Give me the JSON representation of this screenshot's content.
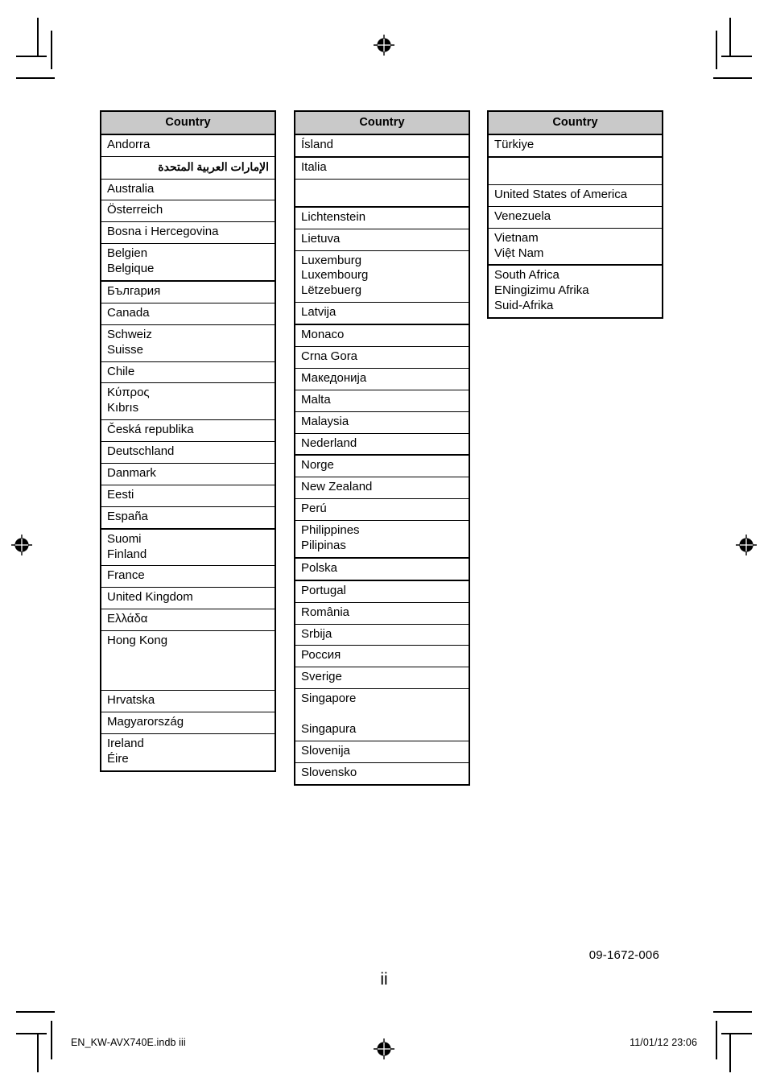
{
  "page": {
    "folio": "ii",
    "doc_code": "09-1672-006",
    "slug_left": "EN_KW-AVX740E.indb   iii",
    "slug_right": "11/01/12   23:06"
  },
  "tables": [
    {
      "name": "country-table-column-1",
      "header": "Country",
      "rows": [
        {
          "text": "Andorra",
          "rule": "thin"
        },
        {
          "text": "الإمارات العربية المتحدة",
          "rule": "thin",
          "dir": "rtl"
        },
        {
          "text": "Australia",
          "rule": "thin"
        },
        {
          "text": "Österreich",
          "rule": "thin"
        },
        {
          "text": "Bosna i Hercegovina",
          "rule": "thin"
        },
        {
          "text": "Belgien\nBelgique",
          "rule": "thick"
        },
        {
          "text": "България",
          "rule": "thin"
        },
        {
          "text": "Canada",
          "rule": "thin"
        },
        {
          "text": "Schweiz\nSuisse",
          "rule": "thin"
        },
        {
          "text": "Chile",
          "rule": "thin"
        },
        {
          "text": "Κύπρος\nKıbrıs",
          "rule": "thin"
        },
        {
          "text": "Česká republika",
          "rule": "thin"
        },
        {
          "text": "Deutschland",
          "rule": "thin"
        },
        {
          "text": "Danmark",
          "rule": "thin"
        },
        {
          "text": "Eesti",
          "rule": "thin"
        },
        {
          "text": "España",
          "rule": "thick"
        },
        {
          "text": "Suomi\nFinland",
          "rule": "thin"
        },
        {
          "text": "France",
          "rule": "thin"
        },
        {
          "text": "United Kingdom",
          "rule": "thin"
        },
        {
          "text": "Ελλάδα",
          "rule": "thin"
        },
        {
          "text": "Hong Kong",
          "rule": "thin",
          "height": "extra-tall"
        },
        {
          "text": "Hrvatska",
          "rule": "thin"
        },
        {
          "text": "Magyarország",
          "rule": "thin"
        },
        {
          "text": "Ireland\nÉire",
          "rule": "none"
        }
      ]
    },
    {
      "name": "country-table-column-2",
      "header": "Country",
      "rows": [
        {
          "text": "Ísland",
          "rule": "thick"
        },
        {
          "text": "Italia",
          "rule": "thin"
        },
        {
          "text": "",
          "rule": "thick",
          "height": "tall-blank"
        },
        {
          "text": "Lichtenstein",
          "rule": "thin"
        },
        {
          "text": "Lietuva",
          "rule": "thin"
        },
        {
          "text": "Luxemburg\nLuxembourg\nLëtzebuerg",
          "rule": "thin"
        },
        {
          "text": "Latvija",
          "rule": "thick"
        },
        {
          "text": "Monaco",
          "rule": "thin"
        },
        {
          "text": "Crna Gora",
          "rule": "thin"
        },
        {
          "text": "Македонија",
          "rule": "thin"
        },
        {
          "text": "Malta",
          "rule": "thin"
        },
        {
          "text": "Malaysia",
          "rule": "thin"
        },
        {
          "text": "Nederland",
          "rule": "thick"
        },
        {
          "text": "Norge",
          "rule": "thin"
        },
        {
          "text": "New Zealand",
          "rule": "thin"
        },
        {
          "text": "Perú",
          "rule": "thin"
        },
        {
          "text": "Philippines\nPilipinas",
          "rule": "thick"
        },
        {
          "text": "Polska",
          "rule": "thick"
        },
        {
          "text": "Portugal",
          "rule": "thin"
        },
        {
          "text": "România",
          "rule": "thin"
        },
        {
          "text": "Srbija",
          "rule": "thin"
        },
        {
          "text": "Россия",
          "rule": "thin"
        },
        {
          "text": "Sverige",
          "rule": "thin"
        },
        {
          "text": "Singapore\n\nSingapura",
          "rule": "thin"
        },
        {
          "text": "Slovenija",
          "rule": "thin"
        },
        {
          "text": "Slovensko",
          "rule": "none"
        }
      ]
    },
    {
      "name": "country-table-column-3",
      "header": "Country",
      "rows": [
        {
          "text": "Türkiye",
          "rule": "thick"
        },
        {
          "text": "",
          "rule": "thin",
          "height": "tall-blank"
        },
        {
          "text": "United States of America",
          "rule": "thin"
        },
        {
          "text": "Venezuela",
          "rule": "thin"
        },
        {
          "text": "Vietnam\nViệt Nam",
          "rule": "thick"
        },
        {
          "text": "South Africa\nENingizimu Afrika\nSuid-Afrika",
          "rule": "none"
        }
      ]
    }
  ],
  "marks": {
    "registration_icon": "registration-target-icon",
    "crop_icon": "crop-mark"
  }
}
